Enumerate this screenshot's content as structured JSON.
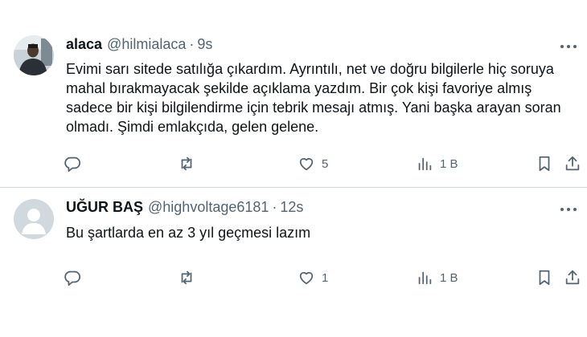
{
  "tweets": [
    {
      "name": "alaca",
      "handle": "@hilmialaca",
      "sep": "·",
      "time": "9s",
      "text": "Evimi sarı sitede satılığa çıkardım. Ayrıntılı, net ve doğru bilgilerle hiç soruya mahal bırakmayacak şekilde açıklama yazdım. Bir çok kişi favoriye almış sadece bir kişi bilgilendirme için tebrik mesajı atmış. Yani başka arayan soran olmadı. Şimdi emlakçıda, gelen gelene.",
      "likes": "5",
      "views": "1 B"
    },
    {
      "name": "UĞUR BAŞ",
      "handle": "@highvoltage6181",
      "sep": "·",
      "time": "12s",
      "text": "Bu şartlarda en az 3 yıl geçmesi lazım",
      "likes": "1",
      "views": "1 B"
    }
  ],
  "icons": {
    "reply": "reply-icon",
    "retweet": "retweet-icon",
    "like": "heart-icon",
    "views": "views-icon",
    "bookmark": "bookmark-icon",
    "share": "share-icon",
    "more": "more-icon"
  },
  "colors": {
    "text": "#0f1419",
    "secondary": "#536471",
    "divider": "#cfd9de",
    "default_avatar_bg": "#cfd9de"
  }
}
